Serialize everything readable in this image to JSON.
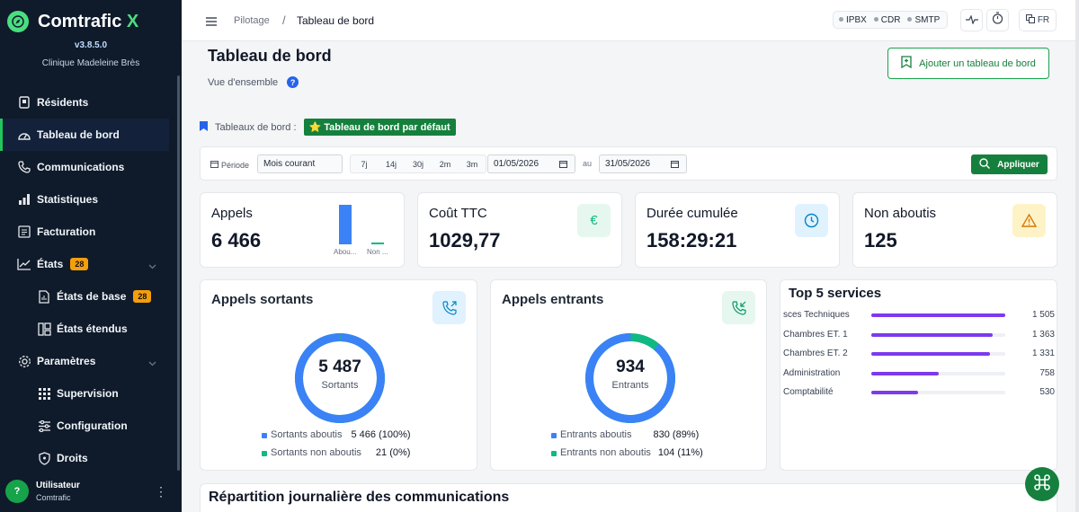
{
  "app": {
    "name": "Comtrafic",
    "name_x": "X",
    "version": "v3.8.5.0",
    "client": "Clinique Madeleine Brès"
  },
  "sidebar": {
    "items": [
      {
        "label": "Résidents"
      },
      {
        "label": "Tableau de bord"
      },
      {
        "label": "Communications"
      },
      {
        "label": "Statistiques"
      },
      {
        "label": "Facturation"
      },
      {
        "label": "États",
        "badge": "28"
      },
      {
        "label": "États de base",
        "badge": "28"
      },
      {
        "label": "États étendus"
      },
      {
        "label": "Paramètres"
      },
      {
        "label": "Supervision"
      },
      {
        "label": "Configuration"
      },
      {
        "label": "Droits"
      }
    ]
  },
  "user": {
    "initial": "?",
    "name": "Utilisateur",
    "org": "Comtrafic"
  },
  "topbar": {
    "breadcrumb_parent": "Pilotage",
    "breadcrumb_sep": "/",
    "breadcrumb_current": "Tableau de bord",
    "services": [
      "IPBX",
      "CDR",
      "SMTP"
    ],
    "lang": "FR"
  },
  "page": {
    "title": "Tableau de bord",
    "subtitle": "Vue d'ensemble",
    "help": "?",
    "add_button": "Ajouter un tableau de bord",
    "dashboards_label": "Tableaux de bord :",
    "default_dashboard": "⭐ Tableau de bord par défaut"
  },
  "filter": {
    "period_label": "Période",
    "period_value": "Mois courant",
    "quick": [
      "7j",
      "14j",
      "30j",
      "2m",
      "3m"
    ],
    "date_from": "01/05/2026",
    "date_sep": "au",
    "date_to": "31/05/2026",
    "apply": "Appliquer"
  },
  "kpis": {
    "appels": {
      "label": "Appels",
      "value": "6 466",
      "bar1_label": "Abou...",
      "bar2_label": "Non ..."
    },
    "cout": {
      "label": "Coût TTC",
      "value": "1029,77",
      "icon": "€"
    },
    "duree": {
      "label": "Durée cumulée",
      "value": "158:29:21"
    },
    "non_aboutis": {
      "label": "Non aboutis",
      "value": "125"
    }
  },
  "sortants": {
    "title": "Appels sortants",
    "value": "5 487",
    "sub": "Sortants",
    "aboutis_fraction": 0.996,
    "legend": [
      {
        "label": "Sortants aboutis",
        "value": "5 466 (100%)",
        "color": "#3b82f6"
      },
      {
        "label": "Sortants non aboutis",
        "value": "21 (0%)",
        "color": "#10b981"
      }
    ]
  },
  "entrants": {
    "title": "Appels entrants",
    "value": "934",
    "sub": "Entrants",
    "aboutis_fraction": 0.89,
    "legend": [
      {
        "label": "Entrants aboutis",
        "value": "830 (89%)",
        "color": "#3b82f6"
      },
      {
        "label": "Entrants non aboutis",
        "value": "104 (11%)",
        "color": "#10b981"
      }
    ]
  },
  "top5": {
    "title": "Top 5 services",
    "max": 1505,
    "items": [
      {
        "name": "sces Techniques",
        "value": 1505,
        "display": "1 505"
      },
      {
        "name": "Chambres ET. 1",
        "value": 1363,
        "display": "1 363"
      },
      {
        "name": "Chambres ET. 2",
        "value": 1331,
        "display": "1 331"
      },
      {
        "name": "Administration",
        "value": 758,
        "display": "758"
      },
      {
        "name": "Comptabilité",
        "value": 530,
        "display": "530"
      }
    ]
  },
  "bottom": {
    "title": "Répartition journalière des communications"
  },
  "colors": {
    "accent": "#15803d",
    "blue": "#3b82f6",
    "green": "#10b981",
    "purple": "#7c3aed",
    "sidebar": "#0f1b2b"
  }
}
